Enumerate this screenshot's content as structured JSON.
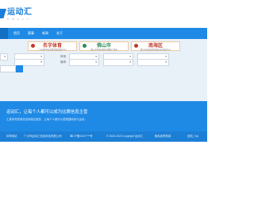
{
  "logo": {
    "text": "运动汇",
    "sub": "D W H C C"
  },
  "nav": [
    "首页",
    "赛事",
    "新闻",
    "关于"
  ],
  "banners": [
    {
      "title": "名字体育",
      "sub": "广州市体育运动赛事组织服务中心",
      "color": "#c0392b"
    },
    {
      "title": "佛山市",
      "sub": "佛山市体育局体育竞赛推广服务",
      "color": "#2e8b57"
    },
    {
      "title": "南海区",
      "sub": "佛山市南海区体育竞技运动促进中心",
      "color": "#c0392b"
    }
  ],
  "row1": [
    {
      "label": "",
      "value": ""
    },
    {
      "label": "年份",
      "value": ""
    },
    {
      "label": "",
      "value": ""
    },
    {
      "label": "",
      "value": ""
    }
  ],
  "row2": [
    {
      "label": "",
      "value": ""
    },
    {
      "label": "城市",
      "value": ""
    },
    {
      "label": "",
      "value": ""
    },
    {
      "label": "",
      "value": ""
    }
  ],
  "band": {
    "title": "运动汇，让每个人都可以成为比赛信息主管",
    "desc": "汇集体育赛事信息和报名服务，让每个人都可以更便捷地参与运动。"
  },
  "footer": {
    "items": [
      "体育网站",
      "广州市运动汇信息科技有限公司",
      "粤ICP备2021****号",
      "© 2020-2023 Copyright 运动汇",
      "隐私政策条款",
      "回到_Top"
    ]
  }
}
